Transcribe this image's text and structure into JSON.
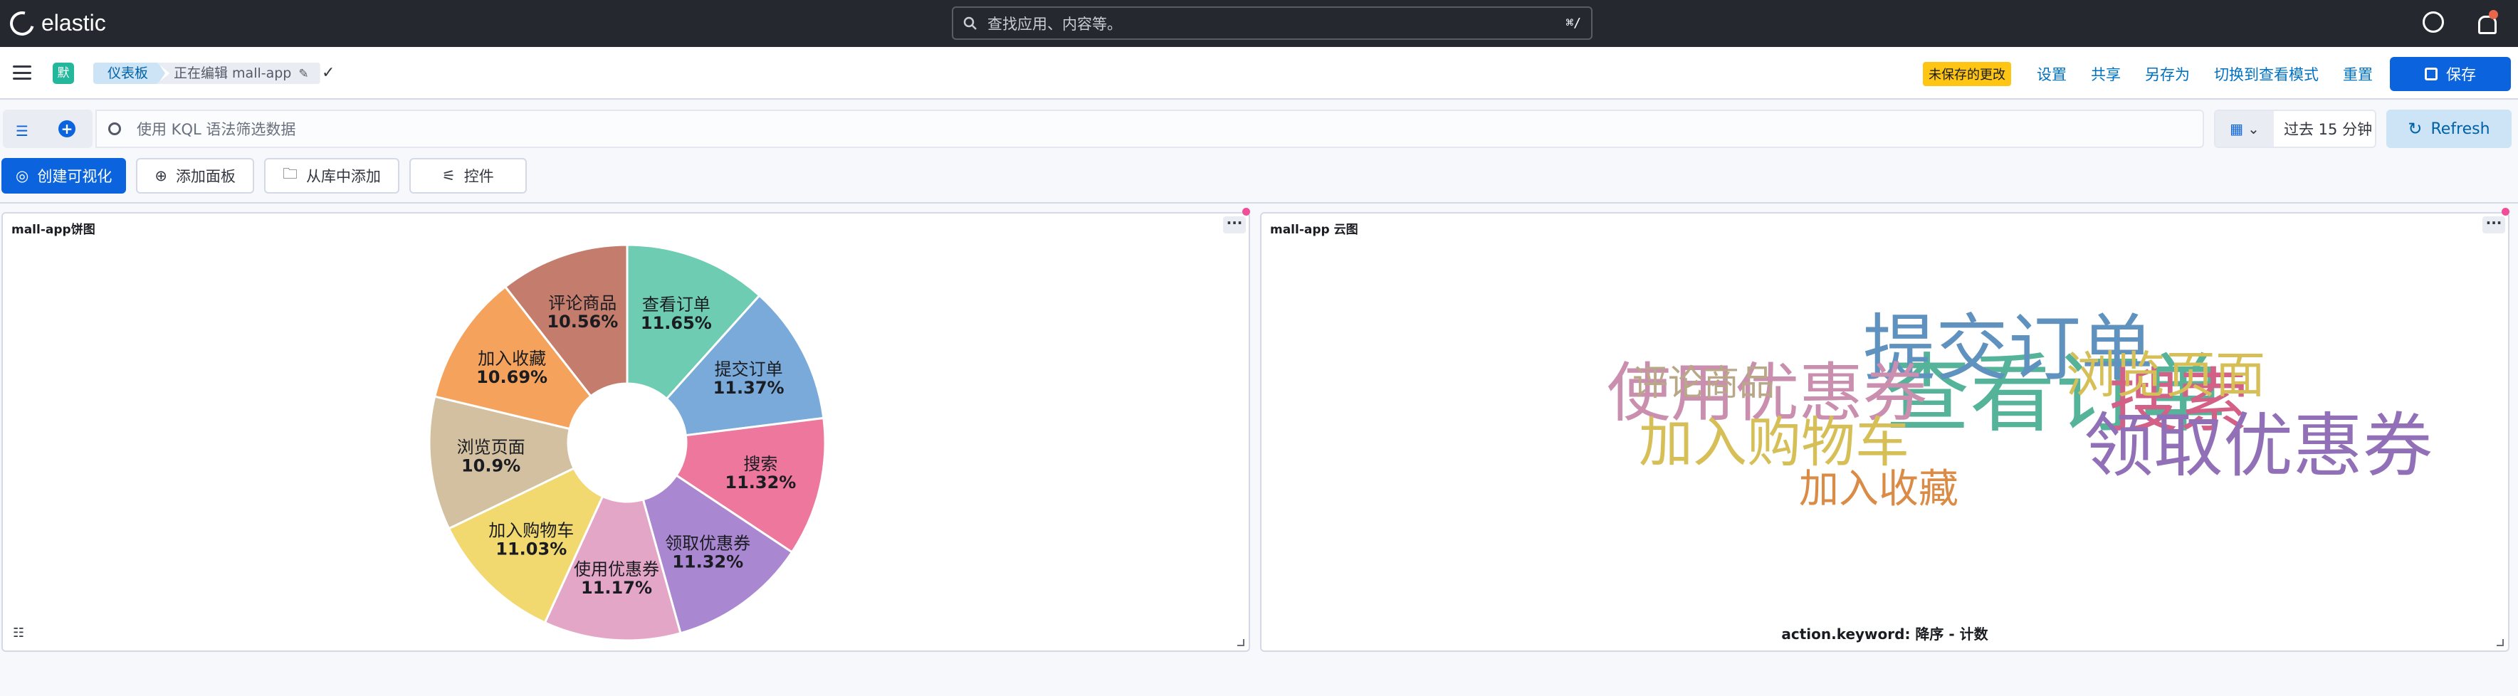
{
  "header": {
    "brand": "elastic",
    "search_placeholder": "查找应用、内容等。",
    "search_shortcut": "⌘/"
  },
  "nav": {
    "space_initial": "默",
    "breadcrumb_dashboard": "仪表板",
    "breadcrumb_editing": "正在编辑 mall-app",
    "unsaved_badge": "未保存的更改",
    "links": [
      "设置",
      "共享",
      "另存为",
      "切换到查看模式",
      "重置"
    ],
    "save_label": "保存"
  },
  "query": {
    "kql_placeholder": "使用 KQL 语法筛选数据",
    "time_range": "过去 15 分钟",
    "refresh_label": "Refresh"
  },
  "toolbar": {
    "create_viz": "创建可视化",
    "add_panel": "添加面板",
    "add_from_library": "从库中添加",
    "controls": "控件"
  },
  "pie_panel": {
    "title": "mall-app饼图"
  },
  "wordcloud_panel": {
    "title": "mall-app 云图",
    "footer": "action.keyword: 降序 - 计数",
    "words": [
      {
        "text": "查看订单",
        "weight": 1.0,
        "color": "#54b399"
      },
      {
        "text": "提交订单",
        "weight": 0.82,
        "color": "#6092c0"
      },
      {
        "text": "搜索",
        "weight": 0.78,
        "color": "#d36086"
      },
      {
        "text": "领取优惠券",
        "weight": 0.78,
        "color": "#9170b8"
      },
      {
        "text": "使用优惠券",
        "weight": 0.7,
        "color": "#ca8eae"
      },
      {
        "text": "浏览页面",
        "weight": 0.5,
        "color": "#d6bf57"
      },
      {
        "text": "加入购物车",
        "weight": 0.56,
        "color": "#d6bf57"
      },
      {
        "text": "评论商品",
        "weight": 0.3,
        "color": "#b9a888"
      },
      {
        "text": "加入收藏",
        "weight": 0.36,
        "color": "#da8b45"
      }
    ]
  },
  "chart_data": {
    "type": "pie",
    "donut": true,
    "slices": [
      {
        "label": "查看订单",
        "value": 11.65,
        "pct_label": "11.65%",
        "color": "#6dccb1"
      },
      {
        "label": "提交订单",
        "value": 11.37,
        "pct_label": "11.37%",
        "color": "#79aad9"
      },
      {
        "label": "搜索",
        "value": 11.32,
        "pct_label": "11.32%",
        "color": "#ee789d"
      },
      {
        "label": "领取优惠券",
        "value": 11.32,
        "pct_label": "11.32%",
        "color": "#a987d1"
      },
      {
        "label": "使用优惠券",
        "value": 11.17,
        "pct_label": "11.17%",
        "color": "#e4a6c7"
      },
      {
        "label": "加入购物车",
        "value": 11.03,
        "pct_label": "11.03%",
        "color": "#f1d86f"
      },
      {
        "label": "浏览页面",
        "value": 10.9,
        "pct_label": "10.9%",
        "color": "#d2c0a0"
      },
      {
        "label": "加入收藏",
        "value": 10.69,
        "pct_label": "10.69%",
        "color": "#f5a35c"
      },
      {
        "label": "评论商品",
        "value": 10.56,
        "pct_label": "10.56%",
        "color": "#c47c6c"
      }
    ]
  }
}
